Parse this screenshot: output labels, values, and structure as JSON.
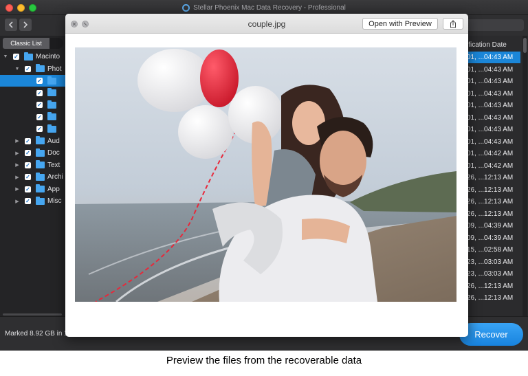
{
  "window": {
    "title": "Stellar Phoenix Mac Data Recovery - Professional"
  },
  "toolbar": {
    "back_icon": "chevron-left-icon",
    "forward_icon": "chevron-right-icon"
  },
  "sidebar": {
    "view_toggle_label": "Classic List",
    "tree": [
      {
        "label": "Macinto",
        "level": 0,
        "expanded": true,
        "checked": true,
        "selected": false
      },
      {
        "label": "Phot",
        "level": 1,
        "expanded": true,
        "checked": true,
        "selected": false
      },
      {
        "label": "",
        "level": 2,
        "expanded": false,
        "checked": true,
        "selected": true
      },
      {
        "label": "",
        "level": 2,
        "expanded": false,
        "checked": true,
        "selected": false
      },
      {
        "label": "",
        "level": 2,
        "expanded": false,
        "checked": true,
        "selected": false
      },
      {
        "label": "",
        "level": 2,
        "expanded": false,
        "checked": true,
        "selected": false
      },
      {
        "label": "",
        "level": 2,
        "expanded": false,
        "checked": true,
        "selected": false
      },
      {
        "label": "Aud",
        "level": 1,
        "expanded": false,
        "checked": true,
        "selected": false
      },
      {
        "label": "Doc",
        "level": 1,
        "expanded": false,
        "checked": true,
        "selected": false
      },
      {
        "label": "Text",
        "level": 1,
        "expanded": false,
        "checked": true,
        "selected": false
      },
      {
        "label": "Archi",
        "level": 1,
        "expanded": false,
        "checked": true,
        "selected": false
      },
      {
        "label": "App",
        "level": 1,
        "expanded": false,
        "checked": true,
        "selected": false
      },
      {
        "label": "Misc",
        "level": 1,
        "expanded": false,
        "checked": true,
        "selected": false
      }
    ]
  },
  "filelist": {
    "column_header": "ification Date",
    "dates": [
      "01, ...04:43 AM",
      "01, ...04:43 AM",
      "01, ...04:43 AM",
      "01, ...04:43 AM",
      "01, ...04:43 AM",
      "01, ...04:43 AM",
      "01, ...04:43 AM",
      "01, ...04:43 AM",
      "01, ...04:42 AM",
      "01, ...04:42 AM",
      "26, ...12:13 AM",
      "26, ...12:13 AM",
      "26, ...12:13 AM",
      "26, ...12:13 AM",
      "09, ...04:39 AM",
      "09, ...04:39 AM",
      "15, ...02:58 AM",
      "23, ...03:03 AM",
      "23, ...03:03 AM",
      "26, ...12:13 AM",
      "26, ...12:13 AM"
    ],
    "selected_index": 0
  },
  "footer": {
    "marked_text": "Marked 8.92 GB in 1",
    "recover_label": "Recover"
  },
  "preview": {
    "filename": "couple.jpg",
    "open_with_label": "Open with Preview",
    "share_icon": "share-icon",
    "close_icon": "close-icon",
    "fullscreen_icon": "fullscreen-icon"
  },
  "caption": "Preview the files from the recoverable data",
  "colors": {
    "accent": "#1b86d8",
    "folder": "#46a6f0",
    "balloon_red": "#e8283a"
  }
}
